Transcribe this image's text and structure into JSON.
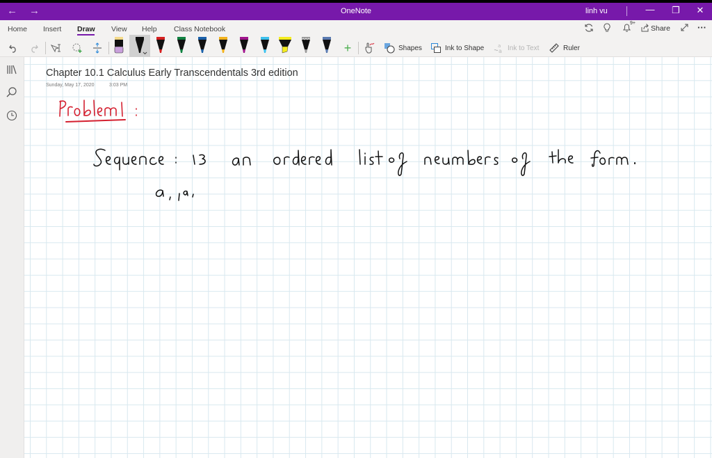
{
  "titlebar": {
    "app_title": "OneNote",
    "user_name": "linh vu",
    "back_icon": "←",
    "forward_icon": "→",
    "minimize_icon": "—",
    "restore_icon": "❐",
    "close_icon": "✕"
  },
  "ribbon": {
    "tabs": [
      {
        "label": "Home"
      },
      {
        "label": "Insert"
      },
      {
        "label": "Draw",
        "active": true
      },
      {
        "label": "View"
      },
      {
        "label": "Help"
      },
      {
        "label": "Class Notebook"
      }
    ],
    "right": {
      "notification_badge": "9+",
      "share_label": "Share",
      "more_label": "···"
    },
    "tools": {
      "shapes_label": "Shapes",
      "ink_to_shape_label": "Ink to Shape",
      "ink_to_text_label": "Ink to Text",
      "ruler_label": "Ruler",
      "add_pen_label": "+"
    },
    "pens": [
      {
        "name": "eraser",
        "color": "#c9a0dc"
      },
      {
        "name": "black-pen",
        "color": "#111111",
        "selected": true
      },
      {
        "name": "red-pen",
        "color": "#d42020"
      },
      {
        "name": "green-pen",
        "color": "#108040"
      },
      {
        "name": "blue-pen",
        "color": "#1a5fa8"
      },
      {
        "name": "orange-pen",
        "color": "#f2b21c"
      },
      {
        "name": "purple-pen",
        "color": "#a0158c"
      },
      {
        "name": "lightblue-pen",
        "color": "#3cc0ec"
      },
      {
        "name": "yellow-highlighter",
        "color": "#f4ec20"
      },
      {
        "name": "galaxy-pen",
        "color": "#9a9a9a"
      },
      {
        "name": "ocean-pen",
        "color": "#5a7ab0"
      }
    ]
  },
  "page": {
    "title": "Chapter 10.1 Calculus Early Transcendentals 3rd edition",
    "date": "Sunday, May 17, 2020",
    "time": "3:03 PM",
    "ink": {
      "heading": "Problem 1 :",
      "heading_color": "#d42030",
      "line1": "Sequence: is an ordered list of numbers of the form.",
      "line2": "a1, a2,",
      "ink_color": "#111111"
    }
  },
  "colors": {
    "accent": "#7719aa"
  }
}
